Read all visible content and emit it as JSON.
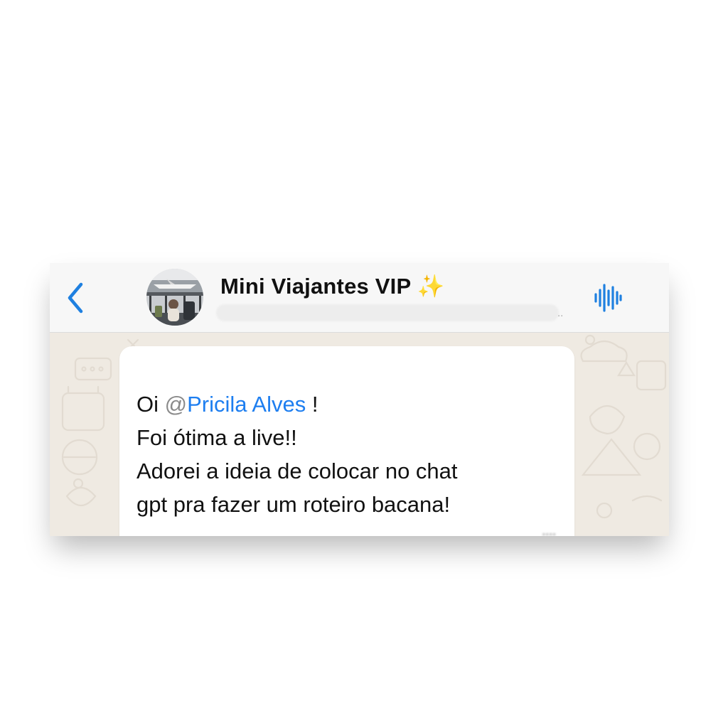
{
  "header": {
    "group_name": "Mini Viajantes VIP",
    "title_emoji": "✨",
    "subtitle_overflow": "..",
    "accent_color": "#1f80e0"
  },
  "icons": {
    "back": "chevron-left-icon",
    "audio": "audio-waveform-icon"
  },
  "message": {
    "greeting": "Oi",
    "mention_at": "@",
    "mention_name": "Pricila Alves",
    "mention_suffix": "!",
    "line2": "Foi ótima a live!!",
    "line3": "Adorei a ideia de colocar no chat",
    "line4": "gpt pra fazer um roteiro bacana!",
    "mention_color": "#1d7ef0"
  }
}
